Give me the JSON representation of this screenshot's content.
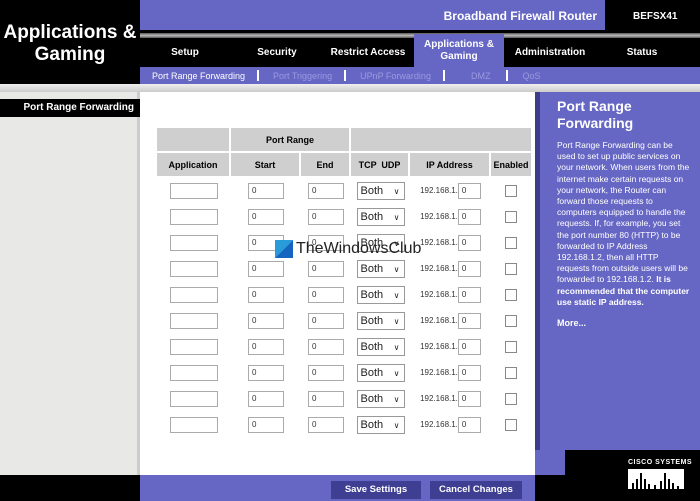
{
  "section_title": "Applications & Gaming",
  "header": {
    "product": "Broadband Firewall Router",
    "model": "BEFSX41"
  },
  "tabs": [
    {
      "label": "Setup"
    },
    {
      "label": "Security"
    },
    {
      "label": "Restrict Access"
    },
    {
      "label": "Applications & Gaming",
      "active": true
    },
    {
      "label": "Administration"
    },
    {
      "label": "Status"
    }
  ],
  "subtabs": [
    {
      "label": "Port Range Forwarding",
      "active": true
    },
    {
      "label": "Port Triggering"
    },
    {
      "label": "UPnP Forwarding"
    },
    {
      "label": "DMZ"
    },
    {
      "label": "QoS"
    }
  ],
  "left_label": "Port Range Forwarding",
  "table": {
    "group_header": "Port Range",
    "columns": [
      "Application",
      "Start",
      "End",
      "TCP  UDP",
      "IP Address",
      "Enabled"
    ],
    "rows": [
      {
        "application": "",
        "start": "0",
        "end": "0",
        "protocol": "Both",
        "ip_prefix": "192.168.1.",
        "ip_last": "0",
        "enabled": false
      },
      {
        "application": "",
        "start": "0",
        "end": "0",
        "protocol": "Both",
        "ip_prefix": "192.168.1.",
        "ip_last": "0",
        "enabled": false
      },
      {
        "application": "",
        "start": "0",
        "end": "0",
        "protocol": "Both",
        "ip_prefix": "192.168.1.",
        "ip_last": "0",
        "enabled": false
      },
      {
        "application": "",
        "start": "0",
        "end": "0",
        "protocol": "Both",
        "ip_prefix": "192.168.1.",
        "ip_last": "0",
        "enabled": false
      },
      {
        "application": "",
        "start": "0",
        "end": "0",
        "protocol": "Both",
        "ip_prefix": "192.168.1.",
        "ip_last": "0",
        "enabled": false
      },
      {
        "application": "",
        "start": "0",
        "end": "0",
        "protocol": "Both",
        "ip_prefix": "192.168.1.",
        "ip_last": "0",
        "enabled": false
      },
      {
        "application": "",
        "start": "0",
        "end": "0",
        "protocol": "Both",
        "ip_prefix": "192.168.1.",
        "ip_last": "0",
        "enabled": false
      },
      {
        "application": "",
        "start": "0",
        "end": "0",
        "protocol": "Both",
        "ip_prefix": "192.168.1.",
        "ip_last": "0",
        "enabled": false
      },
      {
        "application": "",
        "start": "0",
        "end": "0",
        "protocol": "Both",
        "ip_prefix": "192.168.1.",
        "ip_last": "0",
        "enabled": false
      },
      {
        "application": "",
        "start": "0",
        "end": "0",
        "protocol": "Both",
        "ip_prefix": "192.168.1.",
        "ip_last": "0",
        "enabled": false
      }
    ]
  },
  "help": {
    "title": "Port Range Forwarding",
    "body": "Port Range Forwarding can be used to set up public services on your network. When users from the internet make certain requests on your network, the Router can forward those requests to computers equipped to handle the requests. If, for example, you set the port number 80 (HTTP) to be forwarded to IP Address 192.168.1.2, then all HTTP requests from outside users will be forwarded to 192.168.1.2.",
    "bold": "It is recommended that the computer use static IP address.",
    "more": "More..."
  },
  "buttons": {
    "save": "Save Settings",
    "cancel": "Cancel Changes"
  },
  "brand": "Cisco Systems",
  "watermark": "TheWindowsClub",
  "colors": {
    "purple": "#6666c4",
    "black": "#000000",
    "button": "#3e3e92"
  }
}
